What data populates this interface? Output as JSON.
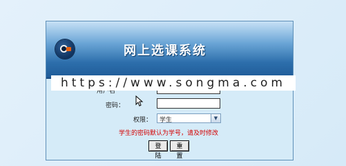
{
  "header": {
    "title": "网上选课系统"
  },
  "form": {
    "username_label": "用户名",
    "username_value": "",
    "password_label": "密码：",
    "password_value": "",
    "role_label": "权限：",
    "role_value": "学生",
    "hint": "学生的密码默认为学号，请及时修改",
    "login_label": "登陆",
    "reset_label": "重置"
  },
  "overlay": {
    "watermark_text": "https://www.songma.com"
  },
  "colors": {
    "header_dark": "#1f5a97",
    "panel_bg": "#d5ebf8",
    "hint_red": "#d40000",
    "logo_accent": "#e8600f"
  },
  "icons": {
    "logo": "circle-logo-icon",
    "select_arrow": "chevron-down-icon",
    "cursor": "mouse-pointer-icon"
  }
}
